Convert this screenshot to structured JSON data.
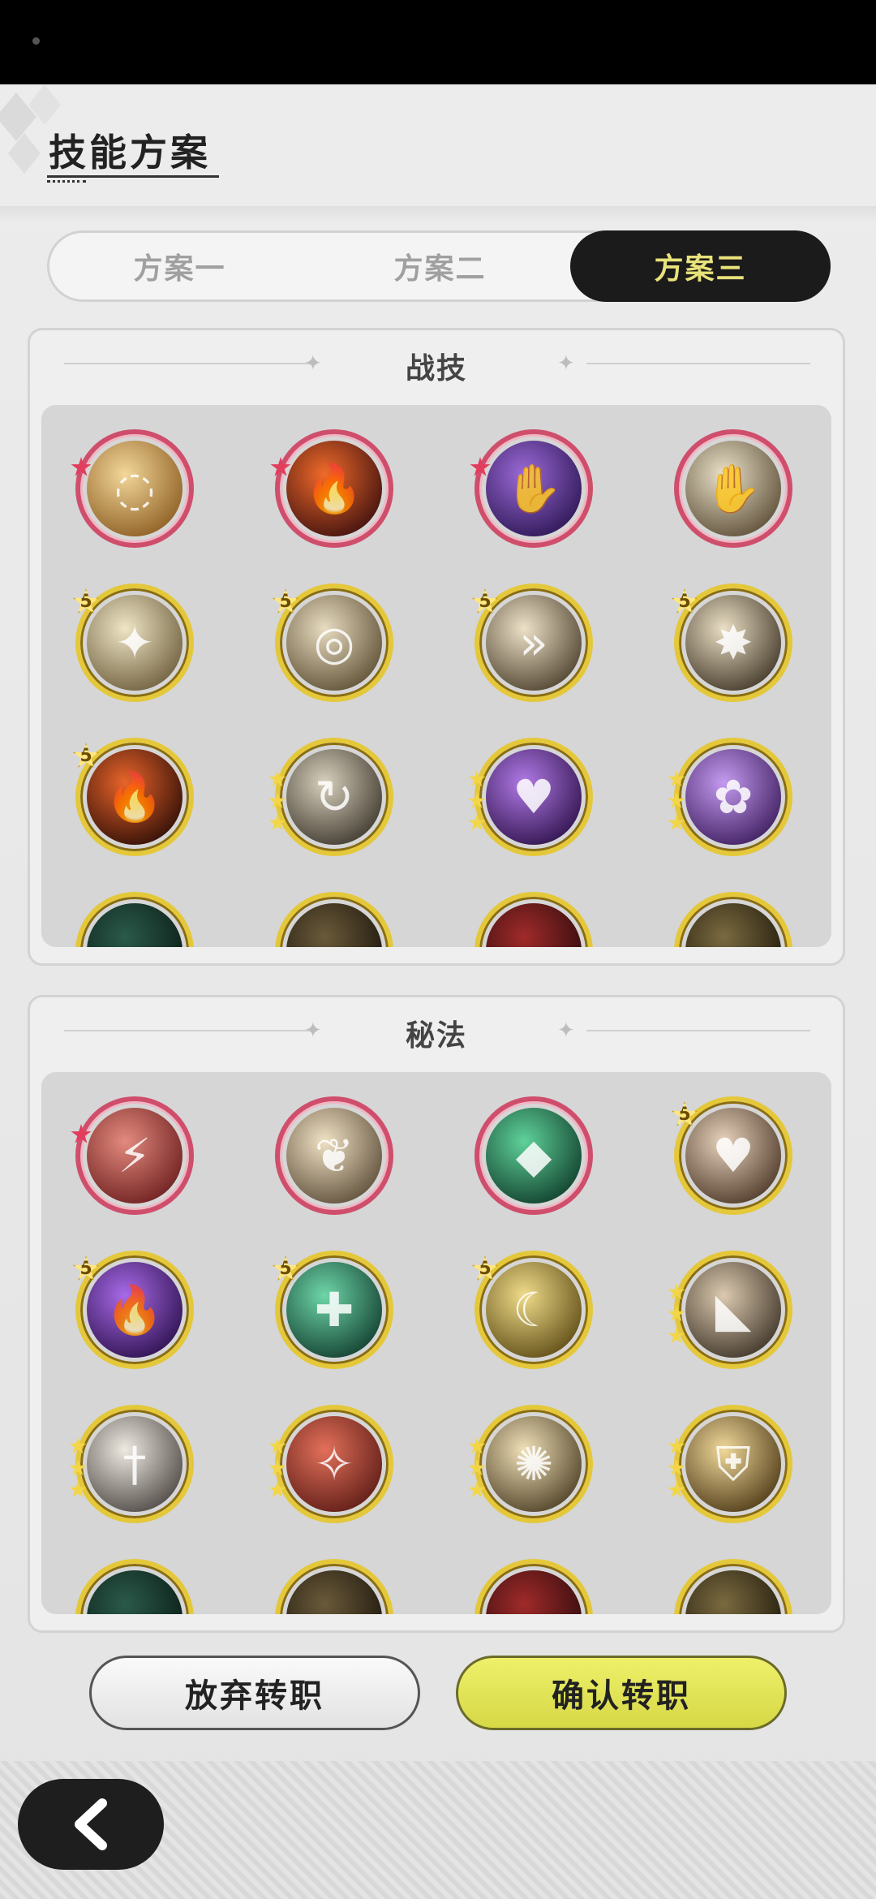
{
  "header": {
    "title": "技能方案"
  },
  "tabs": [
    {
      "label": "方案一",
      "active": false
    },
    {
      "label": "方案二",
      "active": false
    },
    {
      "label": "方案三",
      "active": true
    }
  ],
  "combat_section": {
    "title": "战技",
    "skills": [
      {
        "icon": "golden-swirl-slash-icon",
        "frame": "red",
        "badge": "red-star"
      },
      {
        "icon": "fire-vortex-icon",
        "frame": "red",
        "badge": "red-star"
      },
      {
        "icon": "purple-shadow-hand-icon",
        "frame": "red",
        "badge": "red-star"
      },
      {
        "icon": "sweeping-hand-gust-icon",
        "frame": "red",
        "badge": "none"
      },
      {
        "icon": "sword-burst-icon",
        "frame": "gold",
        "badge": "5"
      },
      {
        "icon": "whirlwind-slash-icon",
        "frame": "gold",
        "badge": "5"
      },
      {
        "icon": "charging-dash-icon",
        "frame": "gold",
        "badge": "5"
      },
      {
        "icon": "leaping-strike-icon",
        "frame": "gold",
        "badge": "5"
      },
      {
        "icon": "fire-aura-icon",
        "frame": "gold",
        "badge": "5"
      },
      {
        "icon": "spinning-slash-icon",
        "frame": "gold",
        "badge": "3-stars"
      },
      {
        "icon": "purple-heart-burst-icon",
        "frame": "gold",
        "badge": "3-stars"
      },
      {
        "icon": "purple-rose-thorns-icon",
        "frame": "gold",
        "badge": "3-stars"
      }
    ]
  },
  "secret_section": {
    "title": "秘法",
    "skills": [
      {
        "icon": "crimson-shield-crack-icon",
        "frame": "red",
        "badge": "red-star"
      },
      {
        "icon": "golden-leaf-icon",
        "frame": "red",
        "badge": "none"
      },
      {
        "icon": "green-crystal-icon",
        "frame": "red",
        "badge": "none"
      },
      {
        "icon": "heart-shield-icon",
        "frame": "gold",
        "badge": "5"
      },
      {
        "icon": "purple-flame-icon",
        "frame": "gold",
        "badge": "5"
      },
      {
        "icon": "green-heal-plus-icon",
        "frame": "gold",
        "badge": "5"
      },
      {
        "icon": "moon-heal-figure-icon",
        "frame": "gold",
        "badge": "5"
      },
      {
        "icon": "roaring-beast-icon",
        "frame": "gold",
        "badge": "3-stars"
      },
      {
        "icon": "sword-emblem-icon",
        "frame": "gold",
        "badge": "3-stars"
      },
      {
        "icon": "red-shatter-icon",
        "frame": "gold",
        "badge": "3-stars"
      },
      {
        "icon": "golden-vortex-icon",
        "frame": "gold",
        "badge": "3-stars"
      },
      {
        "icon": "golden-armor-icon",
        "frame": "gold",
        "badge": "3-stars"
      }
    ]
  },
  "buttons": {
    "abandon": "放弃转职",
    "confirm": "确认转职"
  },
  "nav": {
    "back_icon": "chevron-left-icon"
  },
  "colors": {
    "active_tab_bg": "#1b1b1b",
    "active_tab_text": "#e8e27a",
    "confirm_bg": "#e0e25a",
    "red_frame": "#cf4e6c",
    "gold_frame": "#e4c83a"
  }
}
